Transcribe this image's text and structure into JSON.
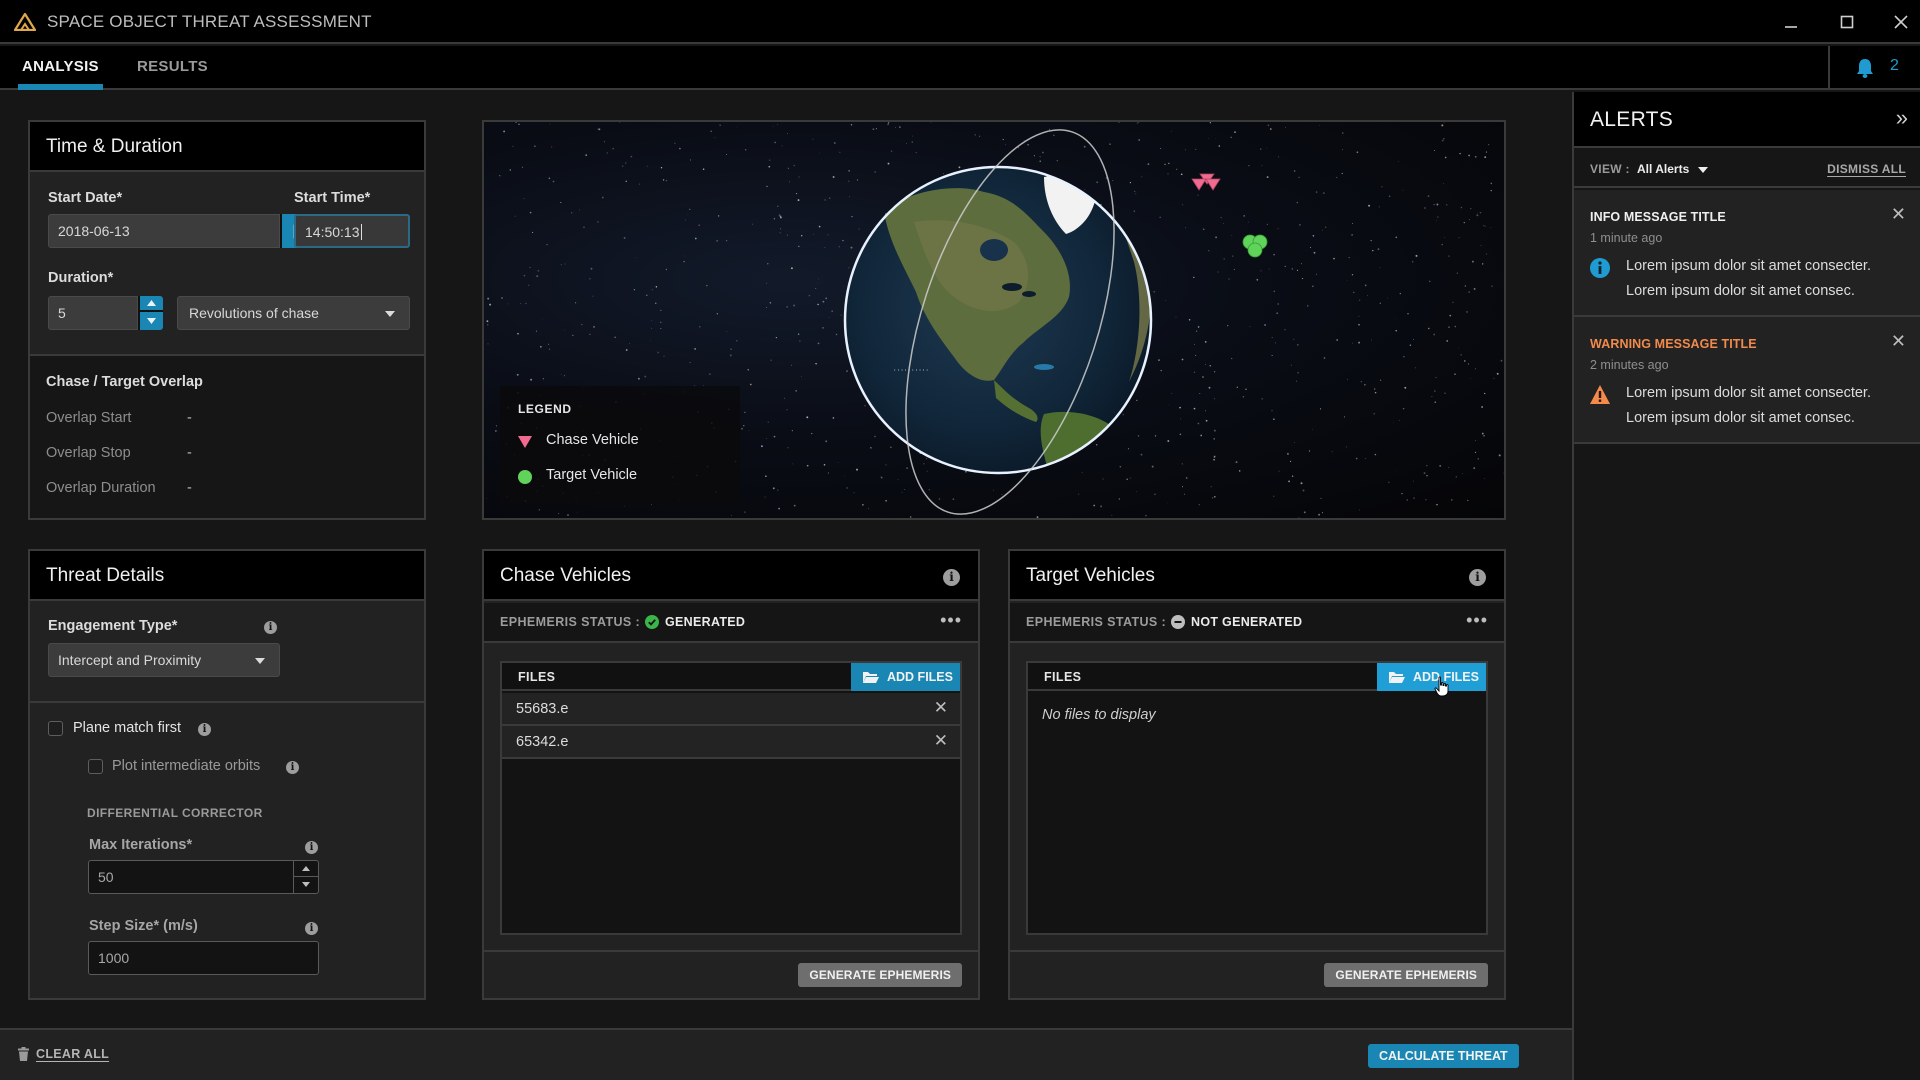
{
  "app": {
    "title": "SPACE OBJECT THREAT ASSESSMENT",
    "window_controls": [
      "minimize-icon",
      "maximize-icon",
      "close-icon"
    ]
  },
  "tabs": [
    {
      "label": "ANALYSIS",
      "active": true
    },
    {
      "label": "RESULTS",
      "active": false
    }
  ],
  "notifications": {
    "icon": "bell-icon",
    "count": "2"
  },
  "time_duration": {
    "title": "Time & Duration",
    "start_date_label": "Start Date*",
    "start_date_value": "2018-06-13",
    "start_time_label": "Start Time*",
    "start_time_value": "14:50:13",
    "duration_label": "Duration*",
    "duration_value": "5",
    "duration_unit": "Revolutions of chase",
    "overlap": {
      "title": "Chase / Target Overlap",
      "rows": [
        {
          "label": "Overlap Start",
          "value": "-"
        },
        {
          "label": "Overlap Stop",
          "value": "-"
        },
        {
          "label": "Overlap Duration",
          "value": "-"
        }
      ]
    }
  },
  "threat_details": {
    "title": "Threat Details",
    "engagement_label": "Engagement Type*",
    "engagement_value": "Intercept and Proximity",
    "plane_match_label": "Plane match first",
    "plane_match_checked": false,
    "plot_orbits_label": "Plot intermediate orbits",
    "plot_orbits_checked": false,
    "diff_corrector_heading": "DIFFERENTIAL CORRECTOR",
    "max_iter_label": "Max Iterations*",
    "max_iter_value": "50",
    "step_size_label": "Step Size* (m/s)",
    "step_size_value": "1000"
  },
  "map": {
    "legend_title": "LEGEND",
    "legend": [
      {
        "label": "Chase Vehicle",
        "symbol": "triangle-down",
        "color": "#f06b8f"
      },
      {
        "label": "Target Vehicle",
        "symbol": "circle",
        "color": "#5fd35a"
      }
    ]
  },
  "chase": {
    "title": "Chase Vehicles",
    "status_label": "EPHEMERIS STATUS :",
    "status_value": "GENERATED",
    "status_color": "#3bb54a",
    "files_header": "FILES",
    "add_files": "ADD FILES",
    "files": [
      "55683.e",
      "65342.e"
    ],
    "generate": "GENERATE EPHEMERIS"
  },
  "target": {
    "title": "Target Vehicles",
    "status_label": "EPHEMERIS STATUS :",
    "status_value": "NOT GENERATED",
    "files_header": "FILES",
    "add_files": "ADD FILES",
    "empty": "No files to display",
    "generate": "GENERATE EPHEMERIS"
  },
  "footer": {
    "clear_all": "CLEAR ALL",
    "calculate": "CALCULATE THREAT"
  },
  "alerts": {
    "title": "ALERTS",
    "view_label": "VIEW :",
    "view_value": "All Alerts",
    "dismiss_all": "DISMISS ALL",
    "items": [
      {
        "type": "info",
        "title": "INFO MESSAGE TITLE",
        "time": "1 minute ago",
        "line1": "Lorem ipsum dolor sit amet consecter.",
        "line2": "Lorem ipsum dolor sit amet consec.",
        "color": "#1f9bd1"
      },
      {
        "type": "warning",
        "title": "WARNING  MESSAGE TITLE",
        "time": "2 minutes ago",
        "line1": "Lorem ipsum dolor sit amet consecter.",
        "line2": "Lorem ipsum dolor sit amet consec.",
        "color": "#f28a4b"
      }
    ]
  },
  "colors": {
    "accent": "#1a86b4",
    "warning": "#f28a4b",
    "info": "#1f9bd1",
    "logo": "#e0a84a"
  }
}
